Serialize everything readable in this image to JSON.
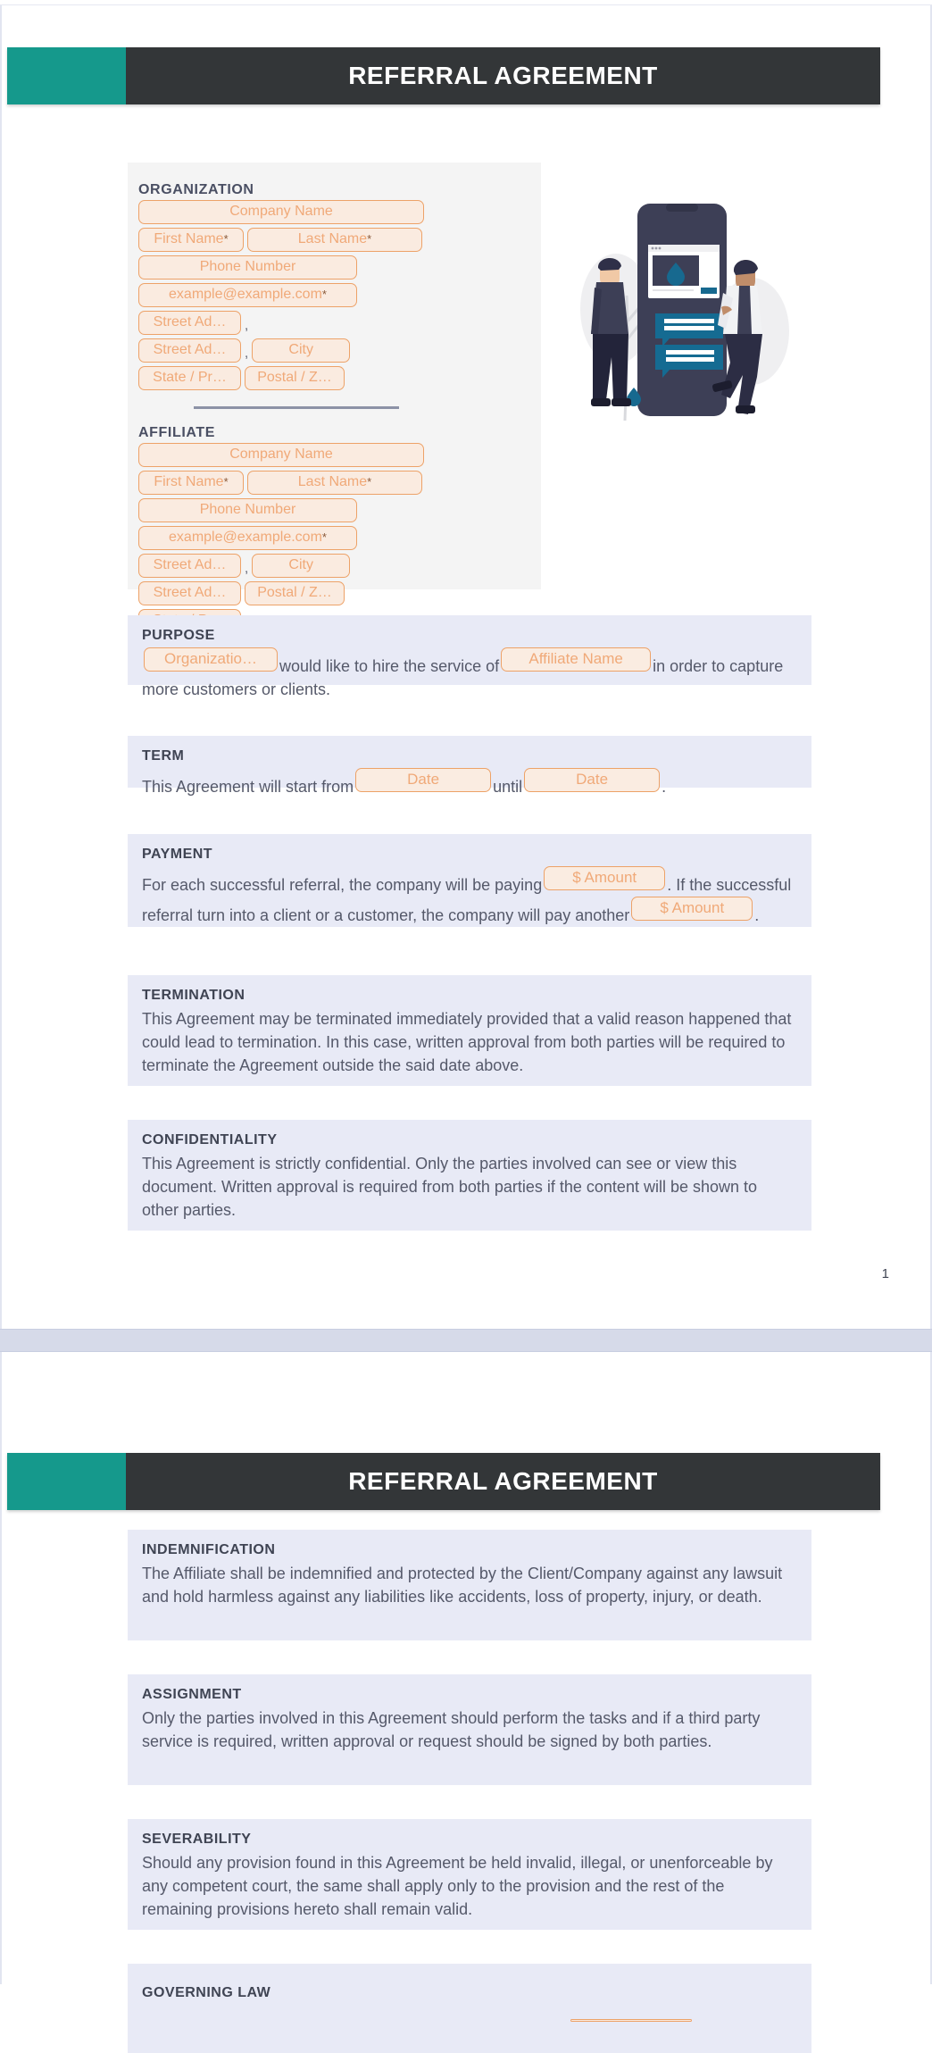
{
  "document": {
    "title": "REFERRAL AGREEMENT",
    "accent_teal": "#15998c",
    "banner_dark": "#333638",
    "clause_bg": "#e8eaf6",
    "field_border": "#eda268",
    "field_fill": "#faebe0",
    "field_text": "#f0a978"
  },
  "page1": {
    "number": "1",
    "banner_title": "REFERRAL AGREEMENT",
    "organization": {
      "label": "ORGANIZATION",
      "company": "Company Name",
      "first_name": "First Name",
      "first_name_required": "*",
      "last_name": "Last Name",
      "last_name_required": "*",
      "phone": "Phone Number",
      "email": "example@example.com",
      "email_required": "*",
      "street1": "Street Ad…",
      "street2": "Street Ad…",
      "city": "City",
      "state": "State / Pr…",
      "postal": "Postal / Z…",
      "sep": ","
    },
    "affiliate": {
      "label": "AFFILIATE",
      "company": "Company Name",
      "first_name": "First Name",
      "first_name_required": "*",
      "last_name": "Last Name",
      "last_name_required": "*",
      "phone": "Phone Number",
      "email": "example@example.com",
      "email_required": "*",
      "street1": "Street Ad…",
      "city": "City",
      "street2": "Street Ad…",
      "postal": "Postal / Z…",
      "state": "State / Pr…",
      "sep": ","
    },
    "clauses": {
      "purpose": {
        "title": "PURPOSE",
        "field_org": "Organizatio…",
        "text_1": "would like to hire the service of",
        "field_affiliate": "Affiliate Name",
        "text_2": "in order to capture more customers or clients."
      },
      "term": {
        "title": "TERM",
        "text_1": "This Agreement will start from",
        "field_start": "Date",
        "text_2": "until",
        "field_end": "Date",
        "text_3": "."
      },
      "payment": {
        "title": "PAYMENT",
        "text_1": "For each successful referral, the company will be paying",
        "field_amount_1": "$ Amount",
        "text_2": ".",
        "text_3": "If the successful referral turn into a client or a customer, the company will pay another",
        "field_amount_2": "$ Amount",
        "text_4": "."
      },
      "termination": {
        "title": "TERMINATION",
        "body": "This Agreement may be terminated immediately provided that a valid reason happened that could lead to termination. In this case, written approval from both parties will be required to terminate the Agreement outside the said date above."
      },
      "confidentiality": {
        "title": "CONFIDENTIALITY",
        "body": "This Agreement is strictly confidential. Only the parties involved can see or view this document. Written approval is required from both parties if the content will be shown to other parties."
      }
    }
  },
  "page2": {
    "banner_title": "REFERRAL AGREEMENT",
    "clauses": {
      "indemnification": {
        "title": "INDEMNIFICATION",
        "body": "The Affiliate shall be indemnified and protected by the Client/Company against any lawsuit and hold harmless against any liabilities like accidents, loss of property, injury, or death."
      },
      "assignment": {
        "title": "ASSIGNMENT",
        "body": "Only the parties involved in this Agreement should perform the tasks and if a third party service is required, written approval or request should be signed by both parties."
      },
      "severability": {
        "title": "SEVERABILITY",
        "body": "Should any provision found in this Agreement be held invalid, illegal, or unenforceable by any competent court, the same shall apply only to the provision and the rest of the remaining provisions hereto shall remain valid."
      },
      "governing_law": {
        "title": "GOVERNING LAW"
      }
    }
  }
}
